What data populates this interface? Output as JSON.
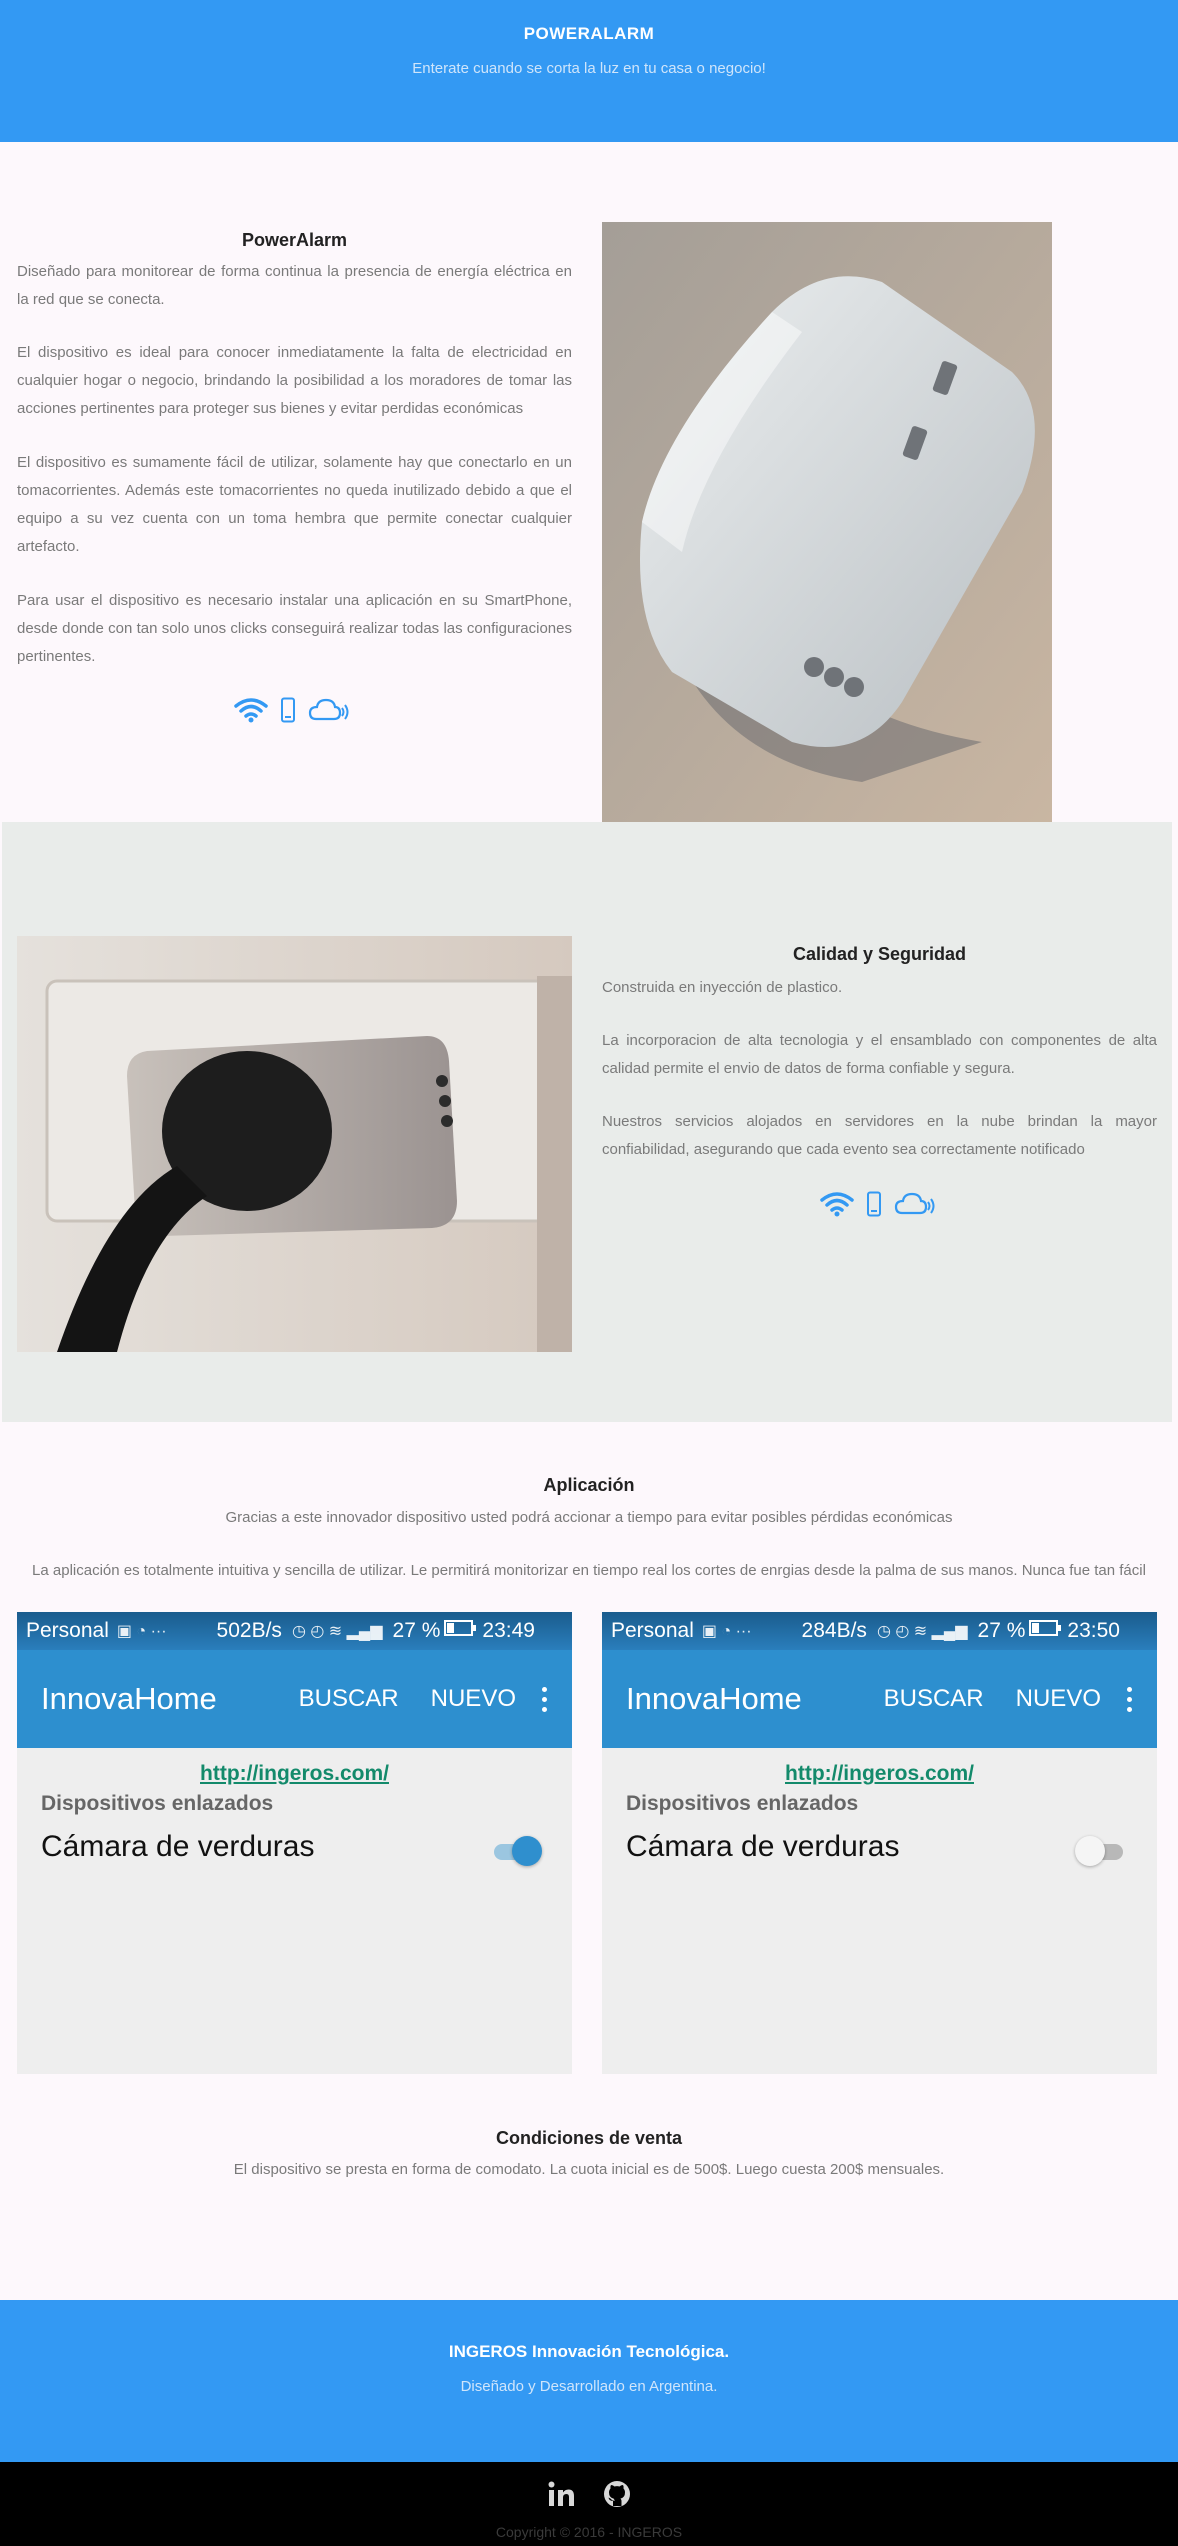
{
  "header": {
    "brand": "POWERALARM",
    "tagline": "Enterate cuando se corta la luz en tu casa o negocio!"
  },
  "section1": {
    "title": "PowerAlarm",
    "paragraphs": [
      "Diseñado para monitorear de forma continua la presencia de energía eléctrica en la red que se conecta.",
      "El dispositivo es ideal para conocer inmediatamente la falta de electricidad en cualquier hogar o negocio, brindando la posibilidad a los moradores de tomar las acciones pertinentes para proteger sus bienes y evitar perdidas económicas",
      "El dispositivo es sumamente fácil de utilizar, solamente hay que conectarlo en un tomacorrientes. Además este tomacorrientes no queda inutilizado debido a que el equipo a su vez cuenta con un toma hembra que permite conectar cualquier artefacto.",
      "Para usar el dispositivo es necesario instalar una aplicación en su SmartPhone, desde donde con tan solo unos clicks conseguirá realizar todas las configuraciones pertinentes."
    ],
    "icons": [
      "wifi-icon",
      "phone-icon",
      "cloud-icon"
    ]
  },
  "section2": {
    "title": "Calidad y Seguridad",
    "paragraphs": [
      "Construida en inyección de plastico.",
      "La incorporacion de alta tecnologia y el ensamblado con componentes de alta calidad permite el envio de datos de forma confiable y segura.",
      "Nuestros servicios alojados en servidores en la nube brindan la mayor confiabilidad, asegurando que cada evento sea correctamente notificado"
    ],
    "icons": [
      "wifi-icon",
      "phone-icon",
      "cloud-icon"
    ]
  },
  "app": {
    "title": "Aplicación",
    "text1": "Gracias a este innovador dispositivo usted podrá accionar a tiempo para evitar posibles pérdidas económicas",
    "text2": "La aplicación es totalmente intuitiva y sencilla de utilizar. Le permitirá monitorizar en tiempo real los cortes de enrgias desde la palma de sus manos. Nunca fue tan fácil",
    "screens": [
      {
        "operator": "Personal",
        "speed": "502B/s",
        "battery": "27 %",
        "time": "23:49",
        "app_title": "InnovaHome",
        "action_search": "BUSCAR",
        "action_new": "NUEVO",
        "link": "http://ingeros.com/",
        "subtitle": "Dispositivos enlazados",
        "device": "Cámara de verduras",
        "toggle_on": true
      },
      {
        "operator": "Personal",
        "speed": "284B/s",
        "battery": "27 %",
        "time": "23:50",
        "app_title": "InnovaHome",
        "action_search": "BUSCAR",
        "action_new": "NUEVO",
        "link": "http://ingeros.com/",
        "subtitle": "Dispositivos enlazados",
        "device": "Cámara de verduras",
        "toggle_on": false
      }
    ]
  },
  "conditions": {
    "title": "Condiciones de venta",
    "text": "El dispositivo se presta en forma de comodato. La cuota inicial es de 500$. Luego cuesta 200$ mensuales."
  },
  "footer": {
    "title": "INGEROS Innovación Tecnológica.",
    "subtitle": "Diseñado y Desarrollado en Argentina.",
    "social": [
      "linkedin-icon",
      "github-icon"
    ],
    "copyright": "Copyright © 2016 - INGEROS"
  },
  "colors": {
    "primary": "#3399f3",
    "background": "#fdf8fc",
    "section_alt": "#e9ecea",
    "app_bar": "#2d8fcf",
    "link": "#138a6b"
  }
}
